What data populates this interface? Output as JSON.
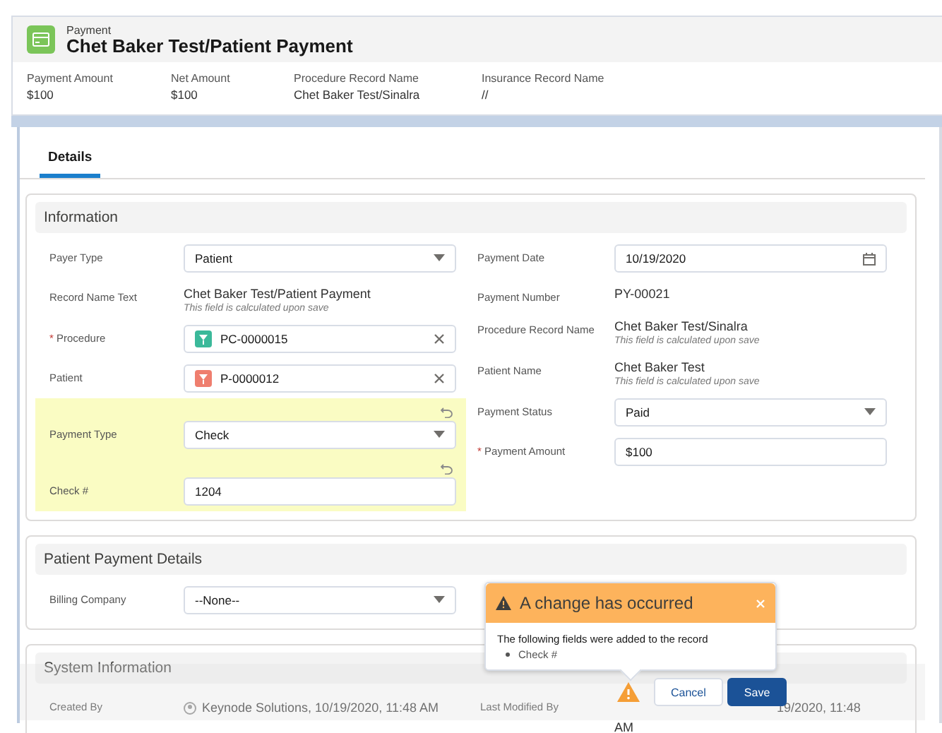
{
  "header": {
    "object": "Payment",
    "title": "Chet Baker Test/Patient Payment"
  },
  "highlights": [
    {
      "label": "Payment Amount",
      "value": "$100"
    },
    {
      "label": "Net Amount",
      "value": "$100"
    },
    {
      "label": "Procedure Record Name",
      "value": "Chet Baker Test/Sinalra"
    },
    {
      "label": "Insurance Record Name",
      "value": "//"
    }
  ],
  "tabs": [
    {
      "label": "Details",
      "selected": true
    }
  ],
  "sections": [
    {
      "title": "Information",
      "columns": [
        [
          {
            "kind": "picklist",
            "label": "Payer Type",
            "value": "Patient",
            "changed": false
          },
          {
            "kind": "text",
            "label": "Record Name Text",
            "value": "Chet Baker Test/Patient Payment",
            "note": "This field is calculated upon save",
            "changed": false
          },
          {
            "kind": "lookup",
            "label": "Procedure",
            "marker": "*",
            "value": "PC-0000015",
            "color": "#3bb99a",
            "changed": false
          },
          {
            "kind": "lookup",
            "label": "Patient",
            "value": "P-0000012",
            "color": "#ef7e6e",
            "changed": false
          },
          {
            "kind": "picklist",
            "label": "Payment Type",
            "value": "Check",
            "changed": true
          },
          {
            "kind": "input",
            "label": "Check #",
            "value": "1204",
            "changed": true
          }
        ],
        [
          {
            "kind": "date",
            "label": "Payment Date",
            "value": "10/19/2020",
            "changed": false
          },
          {
            "kind": "text",
            "label": "Payment Number",
            "value": "PY-00021",
            "changed": false
          },
          {
            "kind": "text",
            "label": "Procedure Record Name",
            "value": "Chet Baker Test/Sinalra",
            "note": "This field is calculated upon save",
            "changed": false
          },
          {
            "kind": "text",
            "label": "Patient Name",
            "value": "Chet Baker Test",
            "note": "This field is calculated upon save",
            "changed": false
          },
          {
            "kind": "picklist",
            "label": "Payment Status",
            "value": "Paid",
            "changed": false
          },
          {
            "kind": "input",
            "label": "Payment Amount",
            "marker": "*",
            "value": "$100",
            "changed": false
          }
        ]
      ]
    },
    {
      "title": "Patient Payment Details",
      "columns": [
        [
          {
            "kind": "picklist",
            "label": "Billing Company",
            "value": "--None--",
            "changed": false
          }
        ]
      ]
    }
  ],
  "system": {
    "title": "System Information",
    "created_by": {
      "label": "Created By",
      "value": "Keynode Solutions, 10/19/2020, 11:48 AM"
    },
    "last_modified_by": {
      "label": "Last Modified By",
      "value_lines": [
        "19/2020, 11:48",
        "AM"
      ]
    }
  },
  "popover": {
    "title": "A change has occurred",
    "message": "The following fields were added to the record",
    "fields": [
      "Check #"
    ]
  },
  "footer": {
    "warning": true,
    "buttons": [
      {
        "label": "Cancel",
        "kind": "neutral"
      },
      {
        "label": "Save",
        "kind": "brand"
      }
    ]
  }
}
